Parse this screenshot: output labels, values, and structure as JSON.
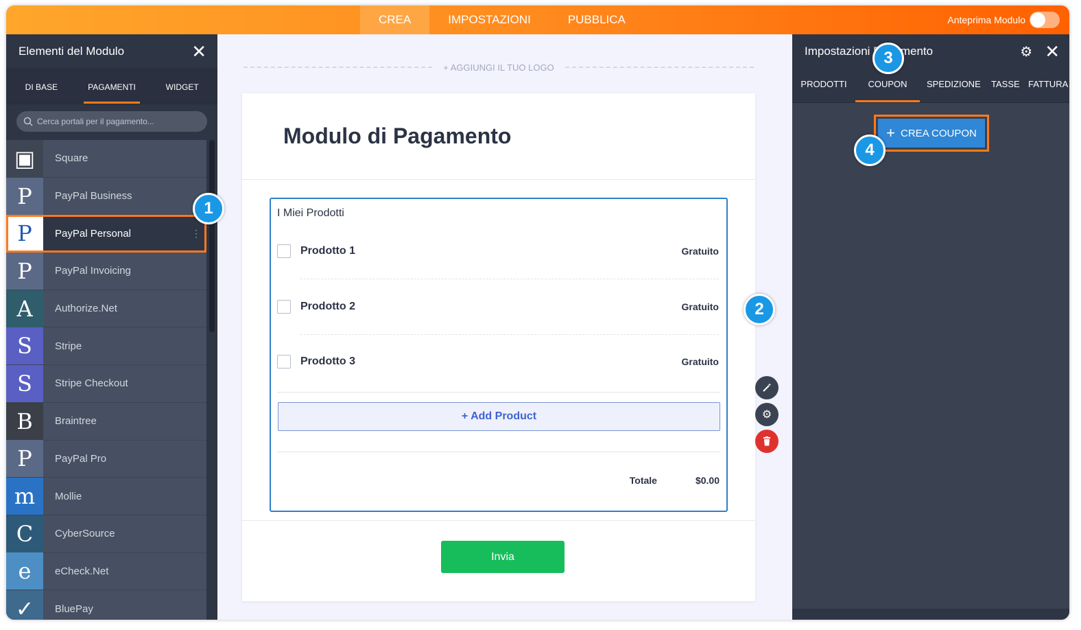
{
  "topbar": {
    "tabs": [
      "CREA",
      "IMPOSTAZIONI",
      "PUBBLICA"
    ],
    "active_tab": "CREA",
    "preview_label": "Anteprima Modulo"
  },
  "left_panel": {
    "title": "Elementi del Modulo",
    "tabs": [
      "DI BASE",
      "PAGAMENTI",
      "WIDGET"
    ],
    "active_tab": "PAGAMENTI",
    "search_placeholder": "Cerca portali per il pagamento...",
    "gateways": [
      {
        "name": "Square",
        "icon": "square-icon",
        "glyph": "▣",
        "color": "#3e4653"
      },
      {
        "name": "PayPal Business",
        "icon": "paypal-business-icon",
        "glyph": "P",
        "color": "#5a6a86"
      },
      {
        "name": "PayPal Personal",
        "icon": "paypal-personal-icon",
        "glyph": "P",
        "color": "#ffffff",
        "selected": true
      },
      {
        "name": "PayPal Invoicing",
        "icon": "paypal-invoicing-icon",
        "glyph": "P",
        "color": "#5a6a86"
      },
      {
        "name": "Authorize.Net",
        "icon": "authorize-net-icon",
        "glyph": "A",
        "color": "#2f5d6b"
      },
      {
        "name": "Stripe",
        "icon": "stripe-icon",
        "glyph": "S",
        "color": "#5a5fc4"
      },
      {
        "name": "Stripe Checkout",
        "icon": "stripe-checkout-icon",
        "glyph": "S",
        "color": "#5a5fc4"
      },
      {
        "name": "Braintree",
        "icon": "braintree-icon",
        "glyph": "B",
        "color": "#3a3f48"
      },
      {
        "name": "PayPal Pro",
        "icon": "paypal-pro-icon",
        "glyph": "P",
        "color": "#5a6a86"
      },
      {
        "name": "Mollie",
        "icon": "mollie-icon",
        "glyph": "m",
        "color": "#2a73c4"
      },
      {
        "name": "CyberSource",
        "icon": "cybersource-icon",
        "glyph": "C",
        "color": "#2e5a7a"
      },
      {
        "name": "eCheck.Net",
        "icon": "echeck-net-icon",
        "glyph": "e",
        "color": "#4d8fc4"
      },
      {
        "name": "BluePay",
        "icon": "bluepay-icon",
        "glyph": "✓",
        "color": "#3e6a8e"
      }
    ]
  },
  "center": {
    "add_logo": "+ AGGIUNGI IL TUO LOGO",
    "form_title": "Modulo di Pagamento",
    "products_label": "I Miei Prodotti",
    "products": [
      {
        "name": "Prodotto 1",
        "price": "Gratuito"
      },
      {
        "name": "Prodotto 2",
        "price": "Gratuito"
      },
      {
        "name": "Prodotto 3",
        "price": "Gratuito"
      }
    ],
    "add_product": "+ Add Product",
    "total_label": "Totale",
    "total_value": "$0.00",
    "submit": "Invia"
  },
  "right_panel": {
    "title": "Impostazioni Pagamento",
    "tabs": [
      "PRODOTTI",
      "COUPON",
      "SPEDIZIONE",
      "TASSE",
      "FATTURA"
    ],
    "active_tab": "COUPON",
    "create_coupon": "CREA COUPON"
  },
  "callouts": [
    "1",
    "2",
    "3",
    "4"
  ],
  "colors": {
    "accent_orange": "#ff7b1c",
    "panel_dark": "#2e3545",
    "primary_blue": "#2f87d6",
    "submit_green": "#18bd5b",
    "callout_blue": "#1a98e5"
  }
}
